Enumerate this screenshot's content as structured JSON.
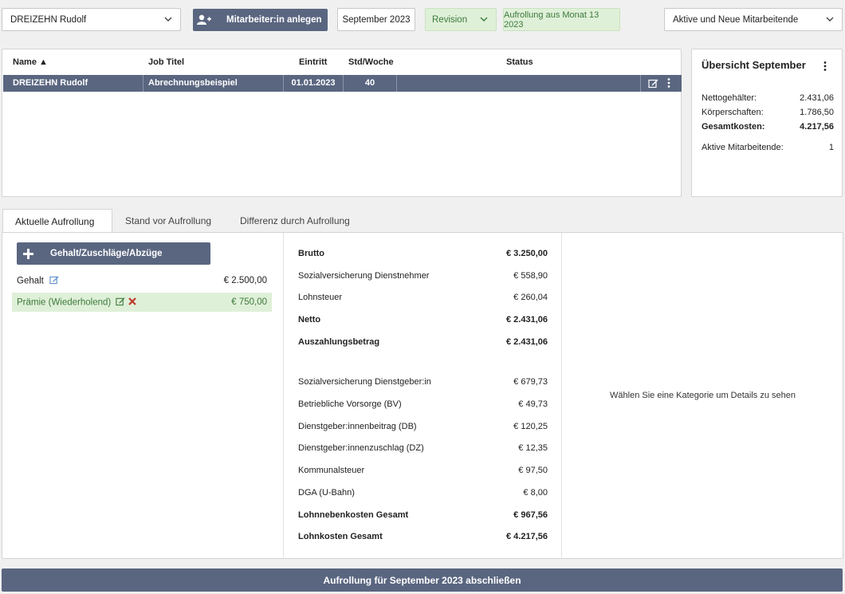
{
  "toolbar": {
    "employee_select": "DREIZEHN Rudolf",
    "add_employee_label": "Mitarbeiter:in anlegen",
    "month": "September 2023",
    "mode_select": "Revision",
    "rollup_info": "Aufrollung aus Monat 13 2023",
    "filter_select": "Aktive und Neue Mitarbeitende"
  },
  "table": {
    "headers": {
      "name": "Name ▲",
      "job": "Job Titel",
      "entry": "Eintritt",
      "hours": "Std/Woche",
      "status": "Status"
    },
    "rows": [
      {
        "name": "DREIZEHN Rudolf",
        "job": "Abrechnungsbeispiel",
        "entry": "01.01.2023",
        "hours": "40",
        "status": ""
      }
    ]
  },
  "overview": {
    "title": "Übersicht September",
    "rows": [
      {
        "label": "Nettogehälter:",
        "value": "2.431,06",
        "bold": false
      },
      {
        "label": "Körperschaften:",
        "value": "1.786,50",
        "bold": false
      },
      {
        "label": "Gesamtkosten:",
        "value": "4.217,56",
        "bold": true
      },
      {
        "label": "Aktive Mitarbeitende:",
        "value": "1",
        "bold": false
      }
    ]
  },
  "tabs": [
    "Aktuelle Aufrollung",
    "Stand vor Aufrollung",
    "Differenz durch Aufrollung"
  ],
  "salary": {
    "add_label": "Gehalt/Zuschläge/Abzüge hinzufügen",
    "items": [
      {
        "label": "Gehalt",
        "value": "€ 2.500,00"
      },
      {
        "label": "Prämie (Wiederholend)",
        "value": "€ 750,00"
      }
    ]
  },
  "calc": {
    "top": [
      {
        "label": "Brutto",
        "value": "€ 3.250,00"
      },
      {
        "label": "Sozialversicherung Dienstnehmer",
        "value": "€ 558,90"
      },
      {
        "label": "Lohnsteuer",
        "value": "€ 260,04"
      },
      {
        "label": "Netto",
        "value": "€ 2.431,06"
      },
      {
        "label": "Auszahlungsbetrag",
        "value": "€ 2.431,06"
      }
    ],
    "bottom": [
      {
        "label": "Sozialversicherung Dienstgeber:in",
        "value": "€ 679,73"
      },
      {
        "label": "Betriebliche Vorsorge (BV)",
        "value": "€ 49,73"
      },
      {
        "label": "Dienstgeber:innenbeitrag (DB)",
        "value": "€ 120,25"
      },
      {
        "label": "Dienstgeber:innenzuschlag (DZ)",
        "value": "€ 12,35"
      },
      {
        "label": "Kommunalsteuer",
        "value": "€ 97,50"
      },
      {
        "label": "DGA (U-Bahn)",
        "value": "€ 8,00"
      },
      {
        "label": "Lohnnebenkosten Gesamt",
        "value": "€ 967,56"
      },
      {
        "label": "Lohnkosten Gesamt",
        "value": "€ 4.217,56"
      }
    ]
  },
  "detail_hint": "Wählen Sie eine Kategorie um Details zu sehen",
  "finish_label": "Aufrollung für September 2023 abschließen",
  "colors": {
    "primary": "#5a6680",
    "success_bg": "#dff0d8",
    "success_text": "#3c7a3c",
    "danger": "#c0392b"
  }
}
